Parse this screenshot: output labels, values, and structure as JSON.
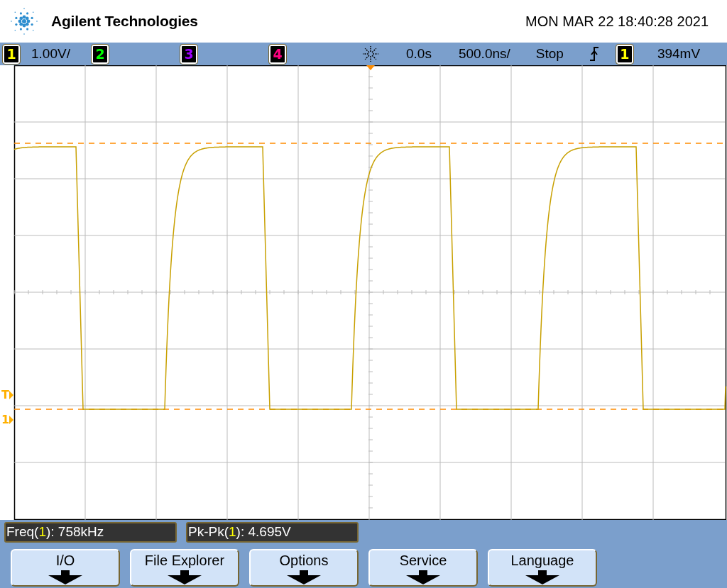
{
  "header": {
    "brand": "Agilent Technologies",
    "datetime": "MON MAR 22 18:40:28 2021"
  },
  "status_bar": {
    "channels": [
      {
        "number": "1",
        "color": "#ffff00",
        "scale": "1.00V/"
      },
      {
        "number": "2",
        "color": "#00ff00"
      },
      {
        "number": "3",
        "color": "#a000ff"
      },
      {
        "number": "4",
        "color": "#ff0080"
      }
    ],
    "trigger_delay": "0.0s",
    "timebase": "500.0ns/",
    "run_state": "Stop",
    "trigger_source": {
      "number": "1",
      "color": "#ffff00"
    },
    "trigger_level": "394mV"
  },
  "graticule": {
    "markers": [
      {
        "label": "T",
        "kind": "trigger"
      },
      {
        "label": "1",
        "kind": "ground"
      }
    ]
  },
  "measurements": [
    {
      "label": "Freq(",
      "channel": "1",
      "rest": "): 758kHz"
    },
    {
      "label": "Pk-Pk(",
      "channel": "1",
      "rest": "): 4.695V"
    }
  ],
  "softkeys": [
    {
      "label": "I/O"
    },
    {
      "label": "File Explorer"
    },
    {
      "label": "Options"
    },
    {
      "label": "Service"
    },
    {
      "label": "Language"
    }
  ]
}
